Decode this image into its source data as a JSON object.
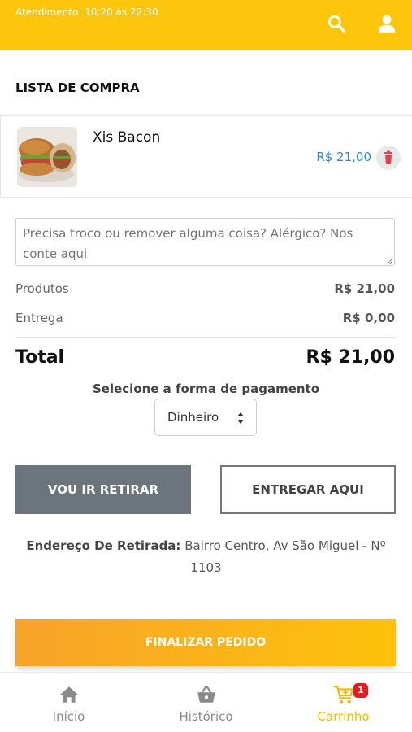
{
  "header": {
    "hours": "Atendimento: 10:20 às 22:30",
    "icons": [
      "search-icon",
      "user-icon"
    ],
    "bg_color": "#fdc50b"
  },
  "cart": {
    "title": "LISTA DE COMPRA",
    "items": [
      {
        "name": "Xis Bacon",
        "price": "R$ 21,00",
        "image": "burger-photo"
      }
    ]
  },
  "note": {
    "placeholder": "Precisa troco ou remover alguma coisa? Alérgico? Nos conte aqui",
    "value": ""
  },
  "summary": {
    "products_label": "Produtos",
    "products_value": "R$ 21,00",
    "delivery_label": "Entrega",
    "delivery_value": "R$ 0,00",
    "total_label": "Total",
    "total_value": "R$ 21,00"
  },
  "payment": {
    "title": "Selecione a forma de pagamento",
    "selected": "Dinheiro"
  },
  "delivery_options": {
    "pickup_label": "VOU IR RETIRAR",
    "deliver_label": "ENTREGAR AQUI",
    "selected": "pickup"
  },
  "address": {
    "label": "Endereço De Retirada:",
    "value": "Bairro Centro, Av São Miguel - Nº 1103"
  },
  "finalize_label": "FINALIZAR PEDIDO",
  "nav": {
    "items": [
      {
        "label": "Início",
        "icon": "home-icon"
      },
      {
        "label": "Histórico",
        "icon": "basket-icon"
      },
      {
        "label": "Carrinho",
        "icon": "cart-icon",
        "badge": "1",
        "active": true
      }
    ],
    "active_color": "#f5b800"
  },
  "colors": {
    "accent": "#fdc50b",
    "price": "#2b8cd6",
    "delete": "#e0424b",
    "pickup_button": "#6c757c"
  }
}
